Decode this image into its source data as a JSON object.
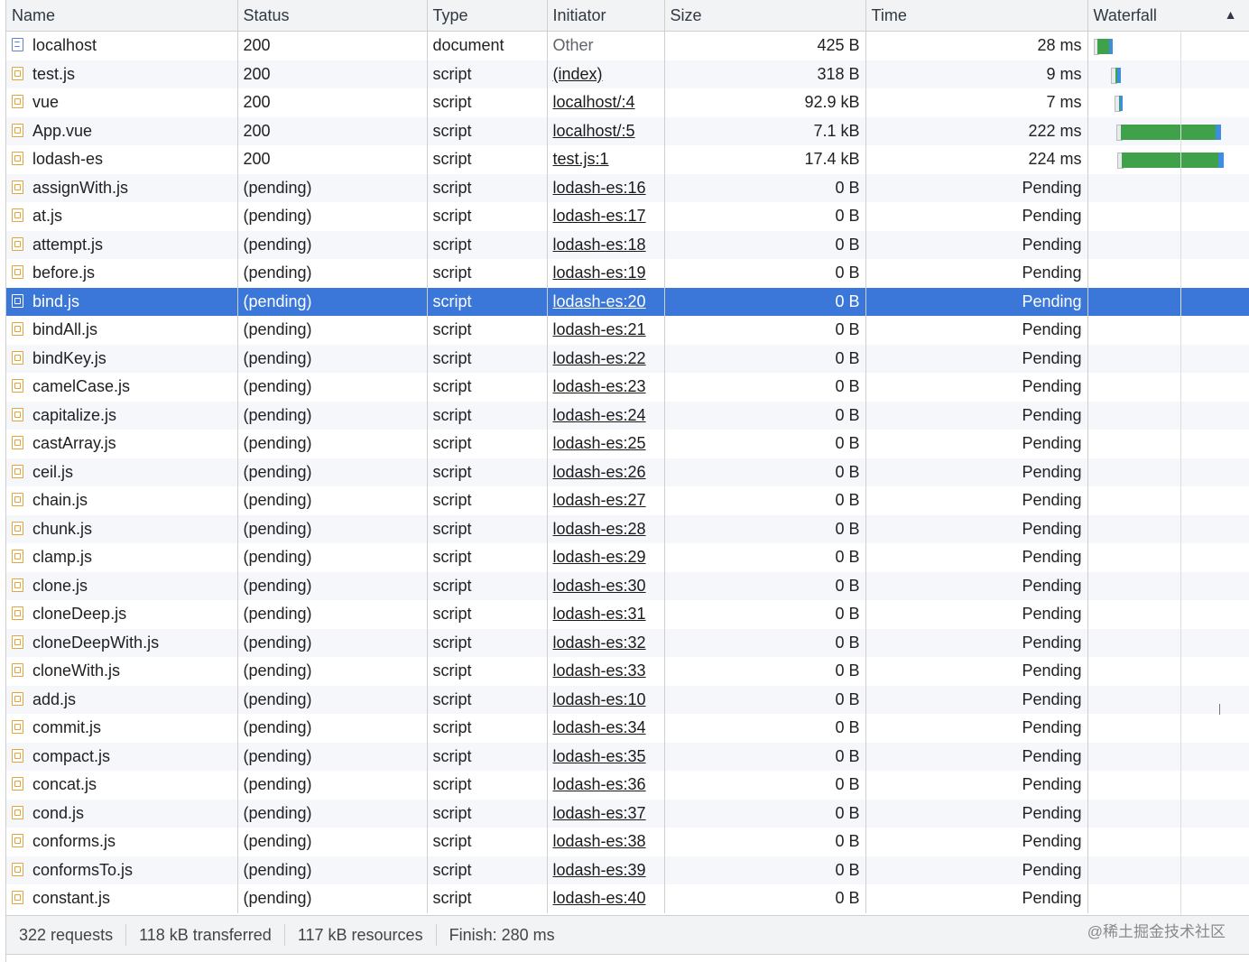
{
  "columns": {
    "name": "Name",
    "status": "Status",
    "type": "Type",
    "initiator": "Initiator",
    "size": "Size",
    "time": "Time",
    "waterfall": "Waterfall",
    "sort_icon": "sort-ascending-icon"
  },
  "rows": [
    {
      "name": "localhost",
      "icon": "document-icon",
      "status": "200",
      "type": "document",
      "initiator": "Other",
      "initiator_link": false,
      "size": "425 B",
      "time": "28 ms"
    },
    {
      "name": "test.js",
      "icon": "script-file-icon",
      "status": "200",
      "type": "script",
      "initiator": "(index)",
      "initiator_link": true,
      "size": "318 B",
      "time": "9 ms"
    },
    {
      "name": "vue",
      "icon": "script-file-icon",
      "status": "200",
      "type": "script",
      "initiator": "localhost/:4",
      "initiator_link": true,
      "size": "92.9 kB",
      "time": "7 ms"
    },
    {
      "name": "App.vue",
      "icon": "script-file-icon",
      "status": "200",
      "type": "script",
      "initiator": "localhost/:5",
      "initiator_link": true,
      "size": "7.1 kB",
      "time": "222 ms"
    },
    {
      "name": "lodash-es",
      "icon": "script-file-icon",
      "status": "200",
      "type": "script",
      "initiator": "test.js:1",
      "initiator_link": true,
      "size": "17.4 kB",
      "time": "224 ms"
    },
    {
      "name": "assignWith.js",
      "icon": "script-file-icon",
      "status": "(pending)",
      "type": "script",
      "initiator": "lodash-es:16",
      "initiator_link": true,
      "size": "0 B",
      "time": "Pending"
    },
    {
      "name": "at.js",
      "icon": "script-file-icon",
      "status": "(pending)",
      "type": "script",
      "initiator": "lodash-es:17",
      "initiator_link": true,
      "size": "0 B",
      "time": "Pending"
    },
    {
      "name": "attempt.js",
      "icon": "script-file-icon",
      "status": "(pending)",
      "type": "script",
      "initiator": "lodash-es:18",
      "initiator_link": true,
      "size": "0 B",
      "time": "Pending"
    },
    {
      "name": "before.js",
      "icon": "script-file-icon",
      "status": "(pending)",
      "type": "script",
      "initiator": "lodash-es:19",
      "initiator_link": true,
      "size": "0 B",
      "time": "Pending"
    },
    {
      "name": "bind.js",
      "icon": "script-file-icon",
      "status": "(pending)",
      "type": "script",
      "initiator": "lodash-es:20",
      "initiator_link": true,
      "size": "0 B",
      "time": "Pending",
      "selected": true
    },
    {
      "name": "bindAll.js",
      "icon": "script-file-icon",
      "status": "(pending)",
      "type": "script",
      "initiator": "lodash-es:21",
      "initiator_link": true,
      "size": "0 B",
      "time": "Pending"
    },
    {
      "name": "bindKey.js",
      "icon": "script-file-icon",
      "status": "(pending)",
      "type": "script",
      "initiator": "lodash-es:22",
      "initiator_link": true,
      "size": "0 B",
      "time": "Pending"
    },
    {
      "name": "camelCase.js",
      "icon": "script-file-icon",
      "status": "(pending)",
      "type": "script",
      "initiator": "lodash-es:23",
      "initiator_link": true,
      "size": "0 B",
      "time": "Pending"
    },
    {
      "name": "capitalize.js",
      "icon": "script-file-icon",
      "status": "(pending)",
      "type": "script",
      "initiator": "lodash-es:24",
      "initiator_link": true,
      "size": "0 B",
      "time": "Pending"
    },
    {
      "name": "castArray.js",
      "icon": "script-file-icon",
      "status": "(pending)",
      "type": "script",
      "initiator": "lodash-es:25",
      "initiator_link": true,
      "size": "0 B",
      "time": "Pending"
    },
    {
      "name": "ceil.js",
      "icon": "script-file-icon",
      "status": "(pending)",
      "type": "script",
      "initiator": "lodash-es:26",
      "initiator_link": true,
      "size": "0 B",
      "time": "Pending"
    },
    {
      "name": "chain.js",
      "icon": "script-file-icon",
      "status": "(pending)",
      "type": "script",
      "initiator": "lodash-es:27",
      "initiator_link": true,
      "size": "0 B",
      "time": "Pending"
    },
    {
      "name": "chunk.js",
      "icon": "script-file-icon",
      "status": "(pending)",
      "type": "script",
      "initiator": "lodash-es:28",
      "initiator_link": true,
      "size": "0 B",
      "time": "Pending"
    },
    {
      "name": "clamp.js",
      "icon": "script-file-icon",
      "status": "(pending)",
      "type": "script",
      "initiator": "lodash-es:29",
      "initiator_link": true,
      "size": "0 B",
      "time": "Pending"
    },
    {
      "name": "clone.js",
      "icon": "script-file-icon",
      "status": "(pending)",
      "type": "script",
      "initiator": "lodash-es:30",
      "initiator_link": true,
      "size": "0 B",
      "time": "Pending"
    },
    {
      "name": "cloneDeep.js",
      "icon": "script-file-icon",
      "status": "(pending)",
      "type": "script",
      "initiator": "lodash-es:31",
      "initiator_link": true,
      "size": "0 B",
      "time": "Pending"
    },
    {
      "name": "cloneDeepWith.js",
      "icon": "script-file-icon",
      "status": "(pending)",
      "type": "script",
      "initiator": "lodash-es:32",
      "initiator_link": true,
      "size": "0 B",
      "time": "Pending"
    },
    {
      "name": "cloneWith.js",
      "icon": "script-file-icon",
      "status": "(pending)",
      "type": "script",
      "initiator": "lodash-es:33",
      "initiator_link": true,
      "size": "0 B",
      "time": "Pending"
    },
    {
      "name": "add.js",
      "icon": "script-file-icon",
      "status": "(pending)",
      "type": "script",
      "initiator": "lodash-es:10",
      "initiator_link": true,
      "size": "0 B",
      "time": "Pending"
    },
    {
      "name": "commit.js",
      "icon": "script-file-icon",
      "status": "(pending)",
      "type": "script",
      "initiator": "lodash-es:34",
      "initiator_link": true,
      "size": "0 B",
      "time": "Pending"
    },
    {
      "name": "compact.js",
      "icon": "script-file-icon",
      "status": "(pending)",
      "type": "script",
      "initiator": "lodash-es:35",
      "initiator_link": true,
      "size": "0 B",
      "time": "Pending"
    },
    {
      "name": "concat.js",
      "icon": "script-file-icon",
      "status": "(pending)",
      "type": "script",
      "initiator": "lodash-es:36",
      "initiator_link": true,
      "size": "0 B",
      "time": "Pending"
    },
    {
      "name": "cond.js",
      "icon": "script-file-icon",
      "status": "(pending)",
      "type": "script",
      "initiator": "lodash-es:37",
      "initiator_link": true,
      "size": "0 B",
      "time": "Pending"
    },
    {
      "name": "conforms.js",
      "icon": "script-file-icon",
      "status": "(pending)",
      "type": "script",
      "initiator": "lodash-es:38",
      "initiator_link": true,
      "size": "0 B",
      "time": "Pending"
    },
    {
      "name": "conformsTo.js",
      "icon": "script-file-icon",
      "status": "(pending)",
      "type": "script",
      "initiator": "lodash-es:39",
      "initiator_link": true,
      "size": "0 B",
      "time": "Pending"
    },
    {
      "name": "constant.js",
      "icon": "script-file-icon",
      "status": "(pending)",
      "type": "script",
      "initiator": "lodash-es:40",
      "initiator_link": true,
      "size": "0 B",
      "time": "Pending"
    }
  ],
  "footer": {
    "requests": "322 requests",
    "transferred": "118 kB transferred",
    "resources": "117 kB resources",
    "finish": "Finish: 280 ms"
  },
  "watermark": "@稀土掘金技术社区",
  "colors": {
    "selected_row": "#3a77d9",
    "waterfall_receive": "#3fa14a",
    "waterfall_download": "#3d8ee0"
  }
}
